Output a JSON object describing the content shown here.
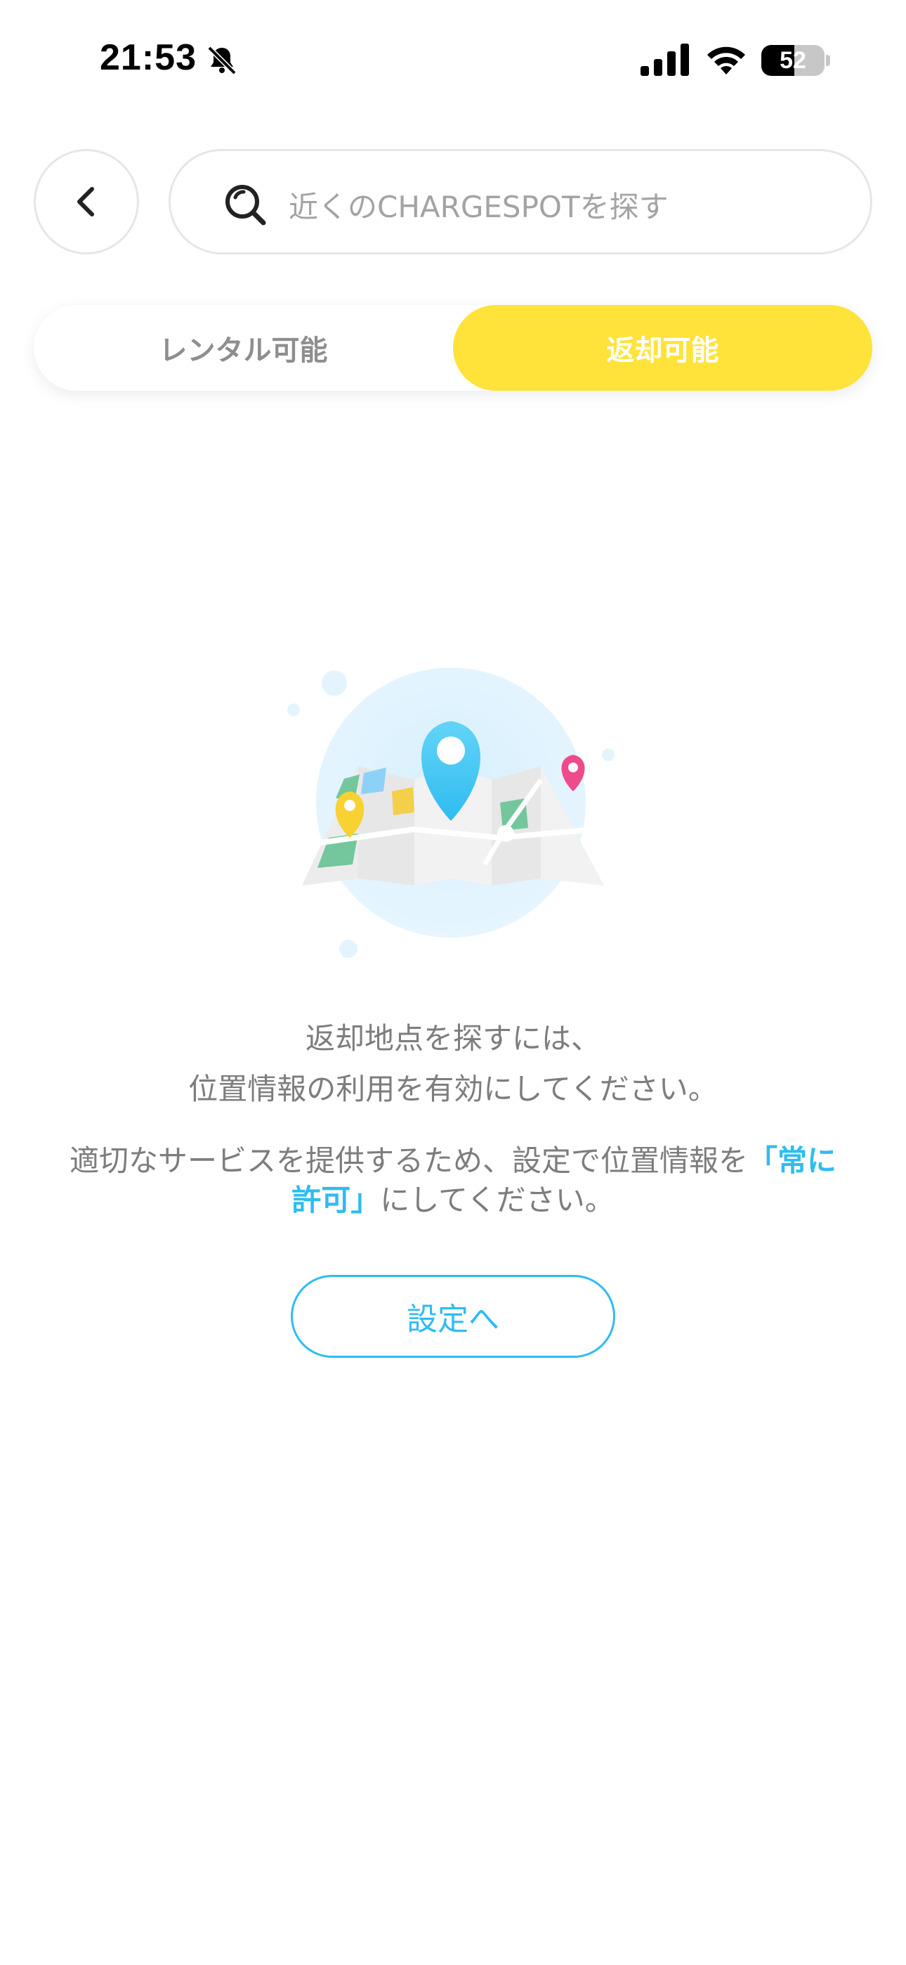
{
  "status_bar": {
    "time": "21:53",
    "battery_level": "52",
    "icons": [
      "bell-slash-icon",
      "cellular-signal-icon",
      "wifi-icon",
      "battery-icon"
    ]
  },
  "header": {
    "back_icon": "chevron-left-icon",
    "search": {
      "icon": "search-icon",
      "placeholder": "近くのCHARGESPOTを探す"
    }
  },
  "tabs": [
    {
      "label": "レンタル可能",
      "selected": false
    },
    {
      "label": "返却可能",
      "selected": true
    }
  ],
  "empty_state": {
    "illustration": "map-pin-illustration",
    "message_line1": "返却地点を探すには、",
    "message_line2": "位置情報の利用を有効にしてください。",
    "sub_prefix": "適切なサービスを提供するため、設定で位置情報を",
    "sub_highlight": "「常に許可」",
    "sub_suffix": "にしてください。",
    "button_label": "設定へ"
  },
  "colors": {
    "accent_yellow": "#ffe33a",
    "accent_blue": "#2fbcf0",
    "text_gray": "#7d7d7d"
  }
}
